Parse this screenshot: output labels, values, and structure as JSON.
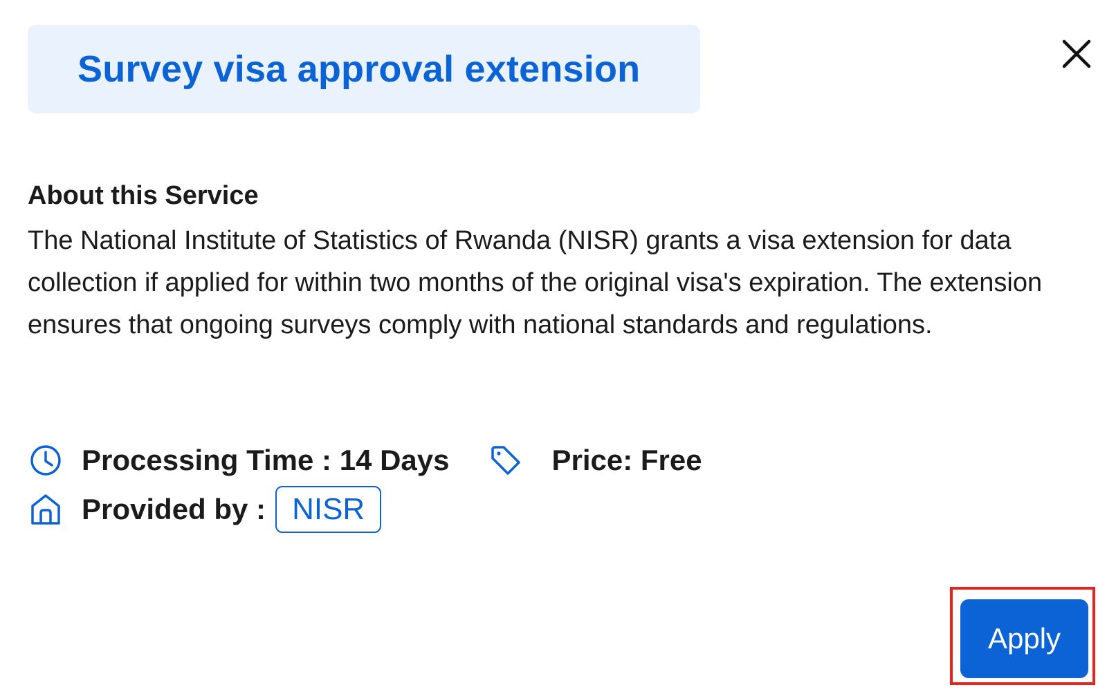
{
  "dialog": {
    "title": "Survey visa approval extension",
    "close_icon": "close-icon"
  },
  "about": {
    "heading": "About this Service",
    "body": "The National Institute of Statistics of Rwanda (NISR) grants a visa extension for data collection if applied for within two months of the original visa's expiration. The extension ensures that ongoing surveys comply with national standards and regulations."
  },
  "details": {
    "processing_time": {
      "icon": "clock-icon",
      "label": "Processing Time : 14 Days"
    },
    "price": {
      "icon": "tag-icon",
      "label": "Price: Free"
    },
    "provider": {
      "icon": "home-icon",
      "label": "Provided by :",
      "value": "NISR"
    }
  },
  "actions": {
    "apply_label": "Apply"
  },
  "colors": {
    "accent": "#0b63d6",
    "title_background": "#eaf2fd",
    "highlight_outline": "#e8251c",
    "text": "#1b1b1b"
  }
}
